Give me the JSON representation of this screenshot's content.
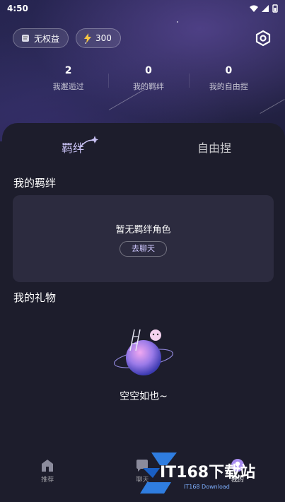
{
  "status_bar": {
    "time": "4:50"
  },
  "topbar": {
    "benefit_label": "无权益",
    "energy_count": "300"
  },
  "stats": [
    {
      "value": "2",
      "label": "我邂逅过"
    },
    {
      "value": "0",
      "label": "我的羁绊"
    },
    {
      "value": "0",
      "label": "我的自由捏"
    }
  ],
  "tabs": [
    {
      "label": "羁绊"
    },
    {
      "label": "自由捏"
    }
  ],
  "bonds_section": {
    "title": "我的羁绊",
    "empty_text": "暂无羁绊角色",
    "chat_button": "去聊天"
  },
  "gifts_section": {
    "title": "我的礼物",
    "empty_text": "空空如也~"
  },
  "bottom_nav": [
    {
      "label": "推荐"
    },
    {
      "label": "聊天"
    },
    {
      "label": "我的"
    }
  ],
  "watermark": {
    "text": "IT168下载站",
    "sub": "IT168 Download"
  },
  "colors": {
    "accent": "#c7c0f2",
    "card": "#2c2b3f",
    "background": "#1d1d2c"
  }
}
